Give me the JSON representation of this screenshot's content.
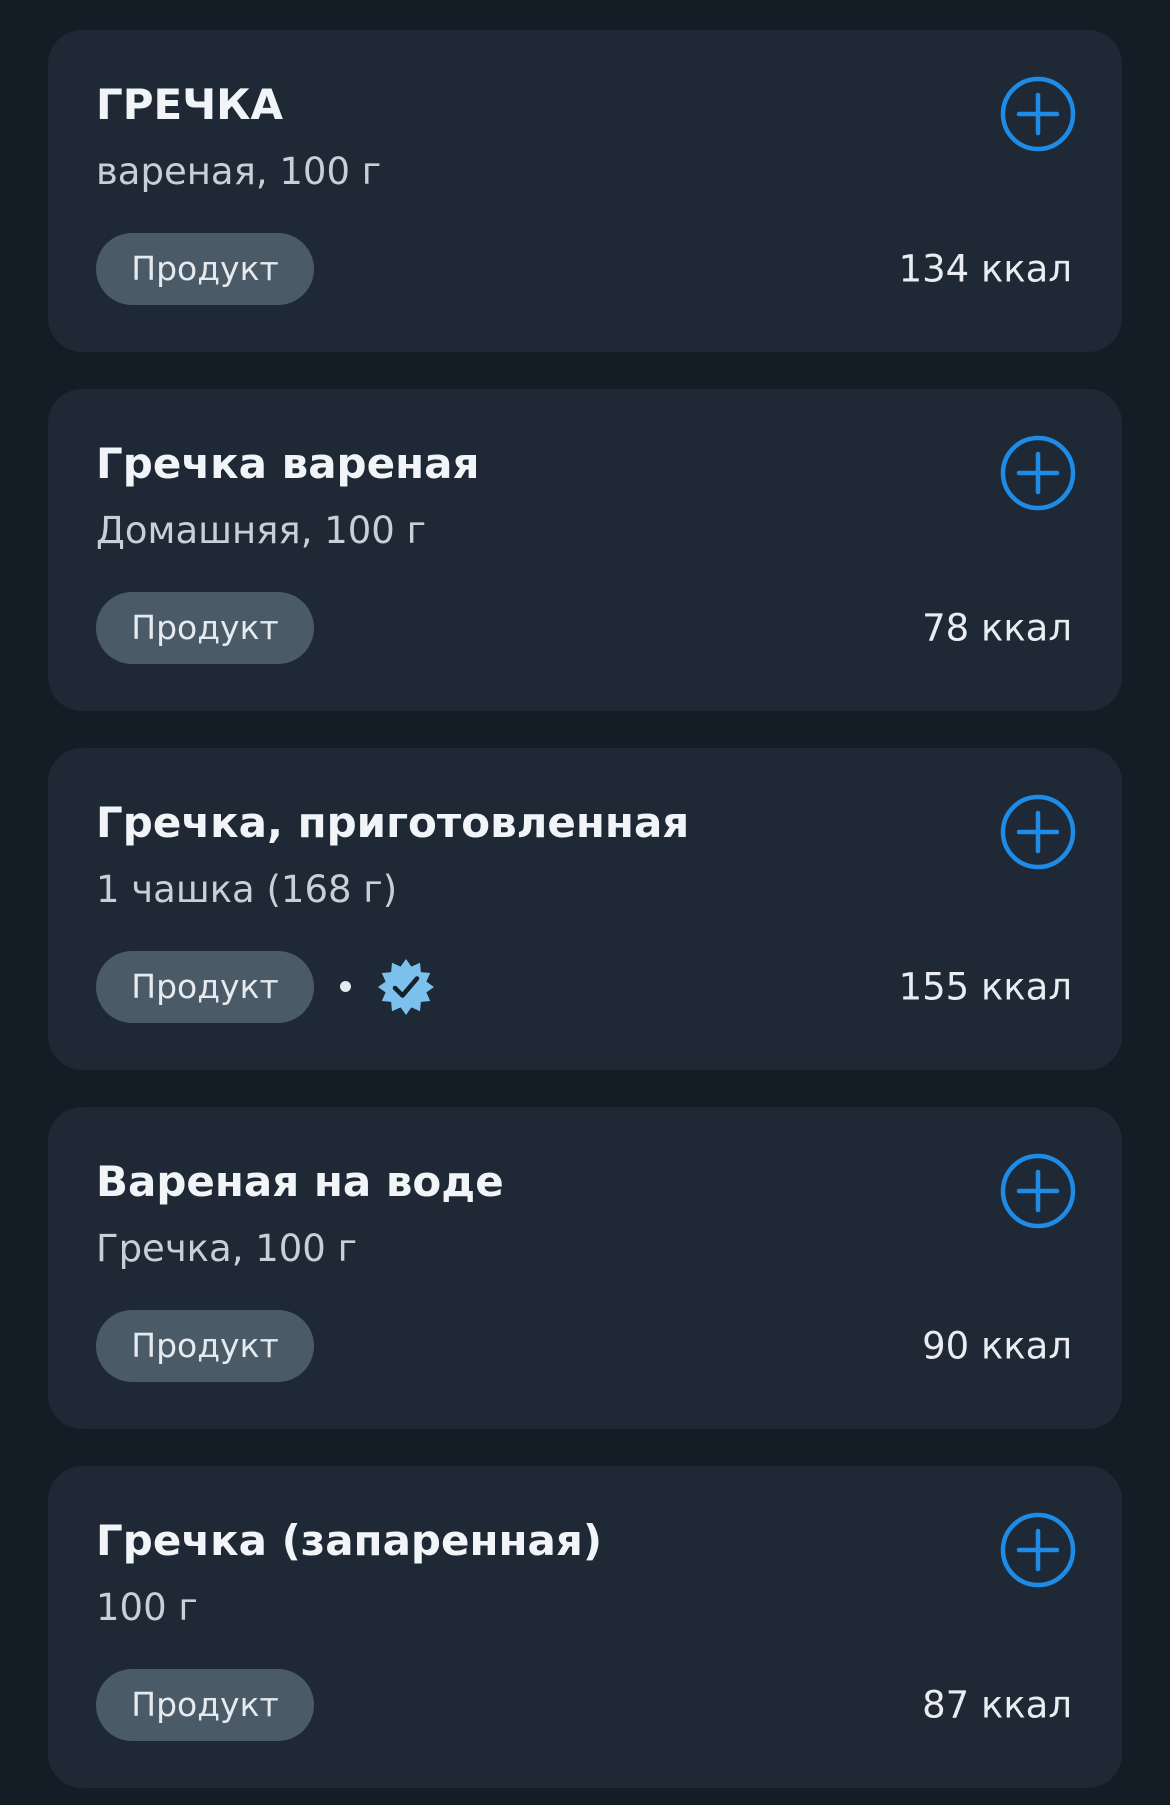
{
  "colors": {
    "background": "#141c26",
    "card": "#1e2935",
    "accent": "#1e8be6",
    "tag": "#4b5a67",
    "verified": "#7cc0ee"
  },
  "items": [
    {
      "title": "ГРЕЧКА",
      "subtitle": "вареная, 100 г",
      "tag": "Продукт",
      "kcal": "134 ккал",
      "verified": false,
      "icon": "plus-circle-icon"
    },
    {
      "title": "Гречка вареная",
      "subtitle": "Домашняя, 100 г",
      "tag": "Продукт",
      "kcal": "78 ккал",
      "verified": false,
      "icon": "plus-circle-icon"
    },
    {
      "title": "Гречка, приготовленная",
      "subtitle": "1 чашка (168 г)",
      "tag": "Продукт",
      "kcal": "155 ккал",
      "verified": true,
      "icon": "plus-circle-icon",
      "badge_icon": "verified-badge-icon"
    },
    {
      "title": "Вареная на воде",
      "subtitle": "Гречка, 100 г",
      "tag": "Продукт",
      "kcal": "90 ккал",
      "verified": false,
      "icon": "plus-circle-icon"
    },
    {
      "title": "Гречка (запаренная)",
      "subtitle": "100 г",
      "tag": "Продукт",
      "kcal": "87 ккал",
      "verified": false,
      "icon": "plus-circle-icon"
    }
  ]
}
